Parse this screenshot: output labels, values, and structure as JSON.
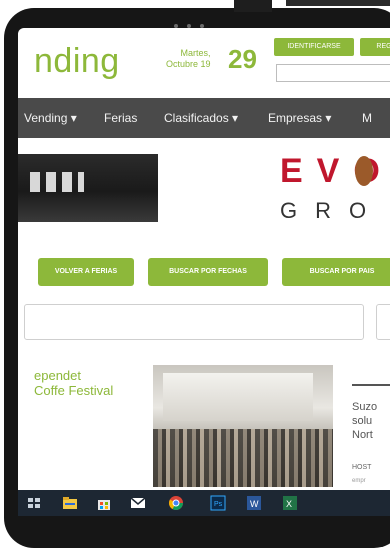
{
  "site": {
    "logo_text": "nding",
    "date_label": "Martes,\nOctubre 19",
    "date_day": "29",
    "buttons": [
      "IDENTIFICARSE",
      "REG"
    ]
  },
  "nav": {
    "items": [
      {
        "label": "Vending ▾",
        "name": "nav-vending"
      },
      {
        "label": "Ferias",
        "name": "nav-ferias"
      },
      {
        "label": "Clasificados ▾",
        "name": "nav-clasificados"
      },
      {
        "label": "Empresas ▾",
        "name": "nav-empresas"
      },
      {
        "label": "M",
        "name": "nav-more"
      }
    ]
  },
  "brand": {
    "line1": "EVO",
    "line2": "GRO"
  },
  "actions": [
    {
      "label": "VOLVER A FERIAS",
      "name": "volver-ferias-button"
    },
    {
      "label": "BUSCAR POR FECHAS",
      "name": "buscar-fechas-button"
    },
    {
      "label": "BUSCAR POR PAIS",
      "name": "buscar-pais-button"
    }
  ],
  "article": {
    "title": "ependet\nCoffe Festival"
  },
  "side_article": {
    "lines": [
      "Suzo",
      "solu",
      "Nort"
    ],
    "meta": "HOST",
    "meta2": "empr"
  },
  "taskbar": {
    "icons": [
      "task-view-icon",
      "file-explorer-icon",
      "store-icon",
      "mail-icon",
      "chrome-icon",
      "photoshop-icon",
      "word-icon",
      "excel-icon"
    ]
  },
  "colors": {
    "accent": "#8db83a",
    "nav_bg": "#4a4a4a",
    "brand_red": "#c0172d",
    "taskbar_bg": "#1d2733"
  }
}
